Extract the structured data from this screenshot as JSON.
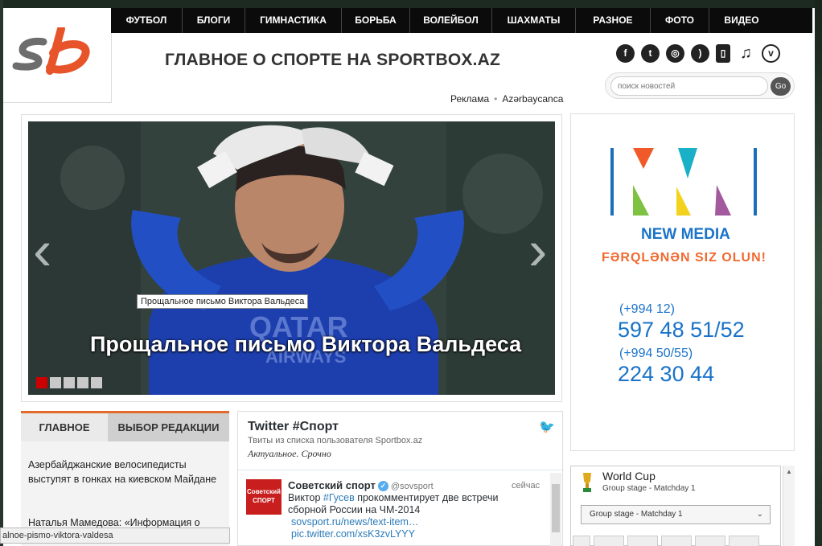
{
  "nav": {
    "items": [
      "ФУТБОЛ",
      "БЛОГИ",
      "ГИМНАСТИКА",
      "БОРЬБА",
      "ВОЛЕЙБОЛ",
      "ШАХМАТЫ",
      "РАЗНОЕ",
      "ФОТО",
      "ВИДЕО"
    ]
  },
  "header": {
    "slogan": "ГЛАВНОЕ О СПОРТЕ НА SPORTBOX.AZ",
    "link_ads": "Реклама",
    "link_lang": "Azərbaycanca",
    "search_placeholder": "поиск новостей",
    "search_button": "Go",
    "social_icons": [
      "facebook-icon",
      "twitter-icon",
      "odnoklassniki-icon",
      "rss-icon",
      "mobile-icon",
      "music-icon",
      "vimeo-icon"
    ]
  },
  "slider": {
    "tooltip": "Прощальное письмо Виктора Вальдеса",
    "title": "Прощальное письмо Виктора Вальдеса",
    "dots": 5,
    "active_dot": 1
  },
  "ad": {
    "brand": "NEW MEDIA",
    "slogan": "FƏRQLƏNƏN  SIZ OLUN!",
    "code1": "(+994 12)",
    "phone1": "597 48 51/52",
    "code2": "(+994 50/55)",
    "phone2": "224 30 44"
  },
  "tabs": {
    "main": "ГЛАВНОЕ",
    "editors": "ВЫБОР РЕДАКЦИИ"
  },
  "news": [
    "Азербайджанские велосипедисты выступят в гонках на киевском Майдане",
    "Наталья Мамедова: «Информация о"
  ],
  "status_url": "alnoe-pismo-viktora-valdesa",
  "twitter": {
    "title": "Twitter #Спорт",
    "subtitle": "Твиты из списка пользователя Sportbox.az",
    "description": "Актуальное. Срочно",
    "author": "Советский спорт",
    "handle": "@sovsport",
    "time": "сейчас",
    "text_pre": "Виктор ",
    "hashtag": "#Гусев",
    "text_post": " прокомментирует две встречи сборной России на ЧМ-2014",
    "link1": "sovsport.ru/news/text-item…",
    "link2": "pic.twitter.com/xsK3zvLYYY",
    "avatar_text": "Советский СПОРТ"
  },
  "worldcup": {
    "title": "World Cup",
    "subtitle": "Group stage - Matchday 1",
    "select_value": "Group stage - Matchday 1"
  },
  "colors": {
    "accent": "#e36a2b",
    "nav_bg": "#0b0b0b",
    "ad_blue": "#1a73c9",
    "ad_orange": "#f06a30",
    "twitter_blue": "#55acee"
  }
}
